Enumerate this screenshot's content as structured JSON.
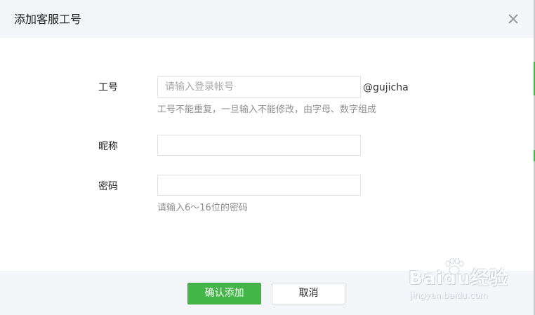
{
  "dialog": {
    "title": "添加客服工号"
  },
  "form": {
    "account": {
      "label": "工号",
      "placeholder": "请输入登录帐号",
      "value": "",
      "suffix": "@gujicha",
      "hint": "工号不能重复，一旦输入不能修改，由字母、数字组成"
    },
    "nickname": {
      "label": "昵称",
      "placeholder": "",
      "value": ""
    },
    "password": {
      "label": "密码",
      "placeholder": "",
      "value": "",
      "hint": "请输入6～16位的密码"
    }
  },
  "footer": {
    "confirm_label": "确认添加",
    "cancel_label": "取消"
  },
  "icons": {
    "close": "close-icon"
  },
  "colors": {
    "primary": "#44b549",
    "header_bg": "#f4f5f9",
    "hint_text": "#8d8d8d"
  },
  "watermark": {
    "logo_text": "Baidu经验",
    "url": "jingyan.baidu.com"
  }
}
